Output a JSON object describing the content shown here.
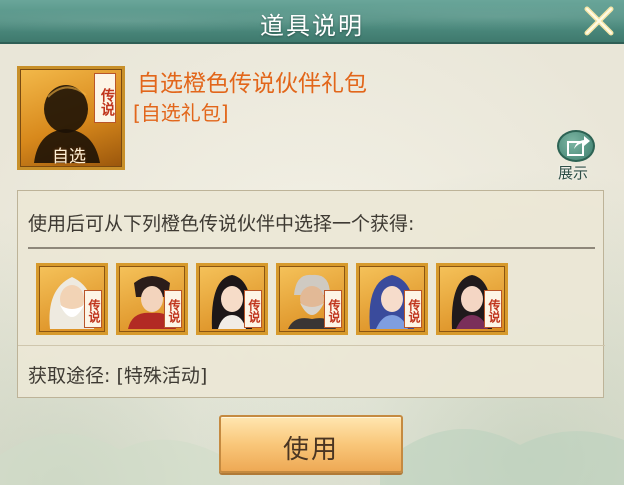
{
  "dialog": {
    "title": "道具说明",
    "close_icon": "close-x-icon"
  },
  "item": {
    "name": "自选橙色传说伙伴礼包",
    "type": "[自选礼包]",
    "icon_label": "自选",
    "badge": "传说",
    "frame_color": "#d8891c"
  },
  "show_button": {
    "label": "展示",
    "icon": "share-arrow-icon"
  },
  "description": {
    "text": "使用后可从下列橙色传说伙伴中选择一个获得:",
    "source": "获取途径: [特殊活动]"
  },
  "partners": [
    {
      "badge": "传说",
      "portrait": "white-haired-elder-portrait"
    },
    {
      "badge": "传说",
      "portrait": "red-robed-lady-portrait"
    },
    {
      "badge": "传说",
      "portrait": "dark-haired-maiden-portrait"
    },
    {
      "badge": "传说",
      "portrait": "grey-bearded-warrior-portrait"
    },
    {
      "badge": "传说",
      "portrait": "blue-haired-lady-portrait"
    },
    {
      "badge": "传说",
      "portrait": "black-haired-lady-portrait"
    }
  ],
  "actions": {
    "use_label": "使用"
  },
  "colors": {
    "title_bar": "#4e8d80",
    "item_text": "#e2661a",
    "legend_badge_text": "#c0341c"
  }
}
